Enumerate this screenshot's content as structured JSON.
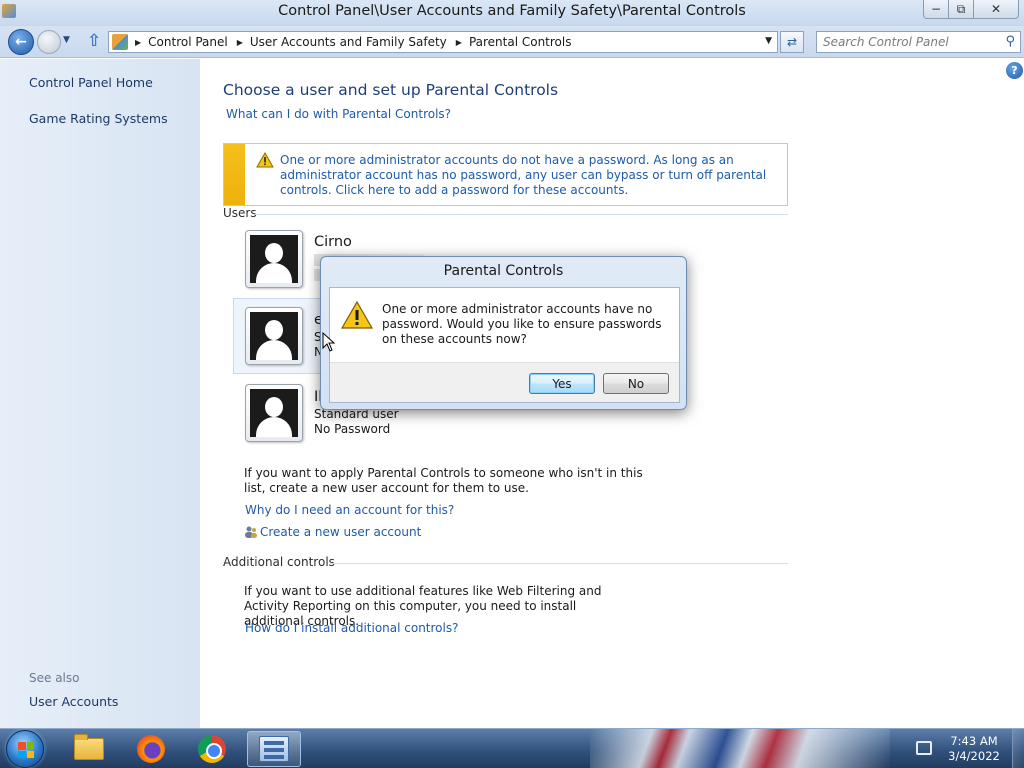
{
  "window": {
    "title": "Control Panel\\User Accounts and Family Safety\\Parental Controls",
    "minimize": "−",
    "maximize": "⧉",
    "close": "✕"
  },
  "address": {
    "crumbs": [
      "Control Panel",
      "User Accounts and Family Safety",
      "Parental Controls"
    ],
    "search_placeholder": "Search Control Panel"
  },
  "sidebar": {
    "items": [
      {
        "label": "Control Panel Home"
      },
      {
        "label": "Game Rating Systems"
      }
    ],
    "see_also_label": "See also",
    "see_also_items": [
      {
        "label": "User Accounts"
      }
    ]
  },
  "main": {
    "title": "Choose a user and set up Parental Controls",
    "what_can_link": "What can I do with Parental Controls?",
    "warning": "One or more administrator accounts do not have a password. As long as an administrator account has no password, any user can bypass or turn off parental controls. Click here to add a password for these accounts.",
    "users_section": "Users",
    "users": [
      {
        "name": "Cirno",
        "type": "",
        "password": ""
      },
      {
        "name": "e",
        "type": "S",
        "password": "N"
      },
      {
        "name": "Il",
        "type": "Standard user",
        "password": "No Password"
      }
    ],
    "apply_text": "If you want to apply Parental Controls to someone who isn't in this list, create a new user account for them to use.",
    "why_link": "Why do I need an account for this?",
    "create_link": "Create a new user account",
    "additional_section": "Additional controls",
    "additional_text": "If you want to use additional features like Web Filtering and Activity Reporting on this computer, you need to install additional controls.",
    "install_link": "How do I install additional controls?"
  },
  "dialog": {
    "title": "Parental Controls",
    "message": "One or more administrator accounts have no password. Would you like to ensure passwords on these accounts now?",
    "yes_label": "Yes",
    "no_label": "No"
  },
  "taskbar": {
    "items": [
      "folder-icon",
      "firefox-icon",
      "chrome-icon",
      "control-panel-icon"
    ],
    "time": "7:43 AM",
    "date": "3/4/2022"
  },
  "colors": {
    "link": "#1f5ba8",
    "warning_bar": "#f4bf1c",
    "title_blue": "#1e3e78"
  }
}
